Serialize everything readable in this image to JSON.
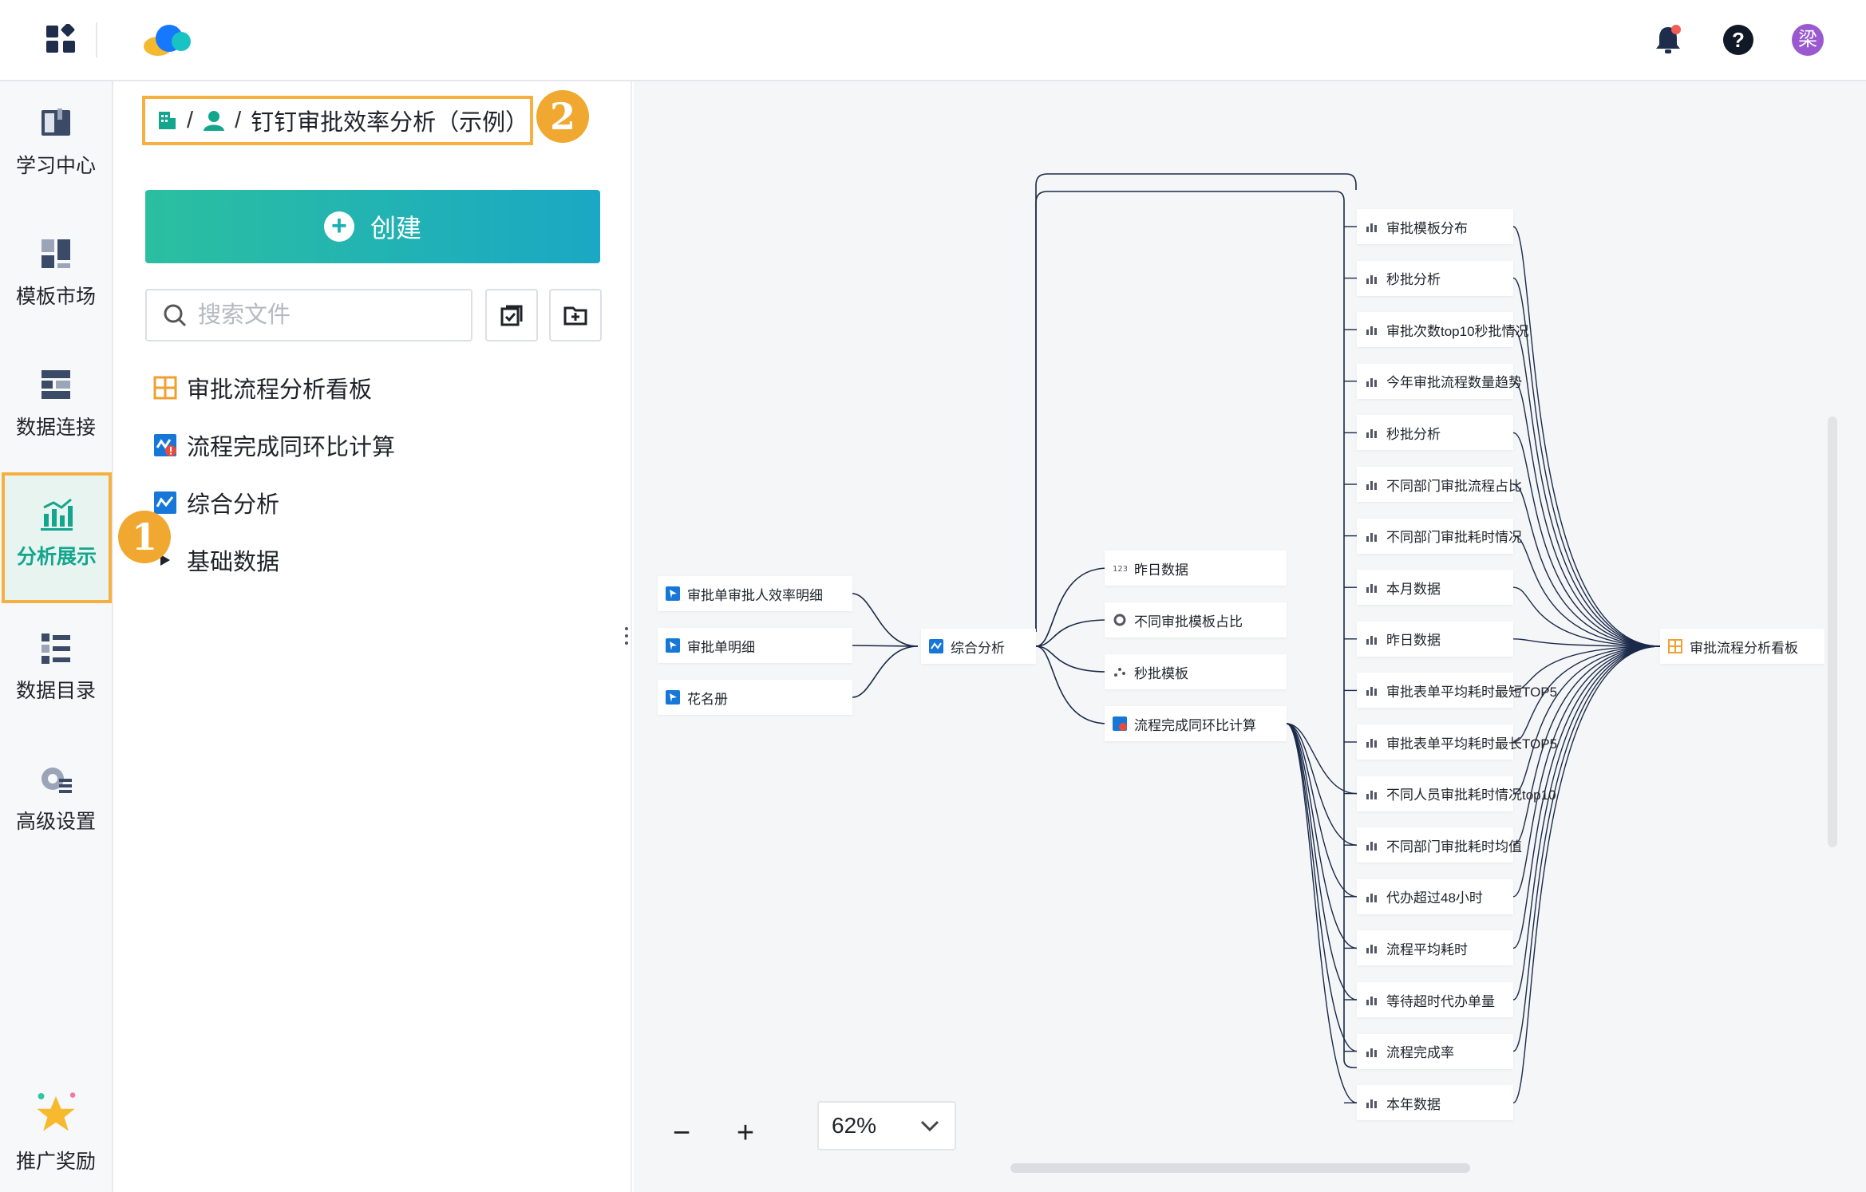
{
  "topbar": {
    "avatar_text": "梁",
    "icons": [
      "apps-grid-icon",
      "cloud-logo-icon",
      "bell-icon",
      "help-icon"
    ],
    "brand_colors": {
      "logo_yellow": "#f5b82e",
      "logo_blue": "#1677ff",
      "logo_teal": "#19c3c3",
      "avatar_bg": "#9b59d0"
    }
  },
  "sidebar": {
    "items": [
      {
        "label": "学习中心",
        "icon": "book-icon"
      },
      {
        "label": "模板市场",
        "icon": "template-icon"
      },
      {
        "label": "数据连接",
        "icon": "database-link-icon"
      },
      {
        "label": "分析展示",
        "icon": "chart-icon",
        "active": true
      },
      {
        "label": "数据目录",
        "icon": "catalog-icon"
      },
      {
        "label": "高级设置",
        "icon": "settings-icon"
      }
    ],
    "promo": {
      "label": "推广奖励",
      "icon": "star-icon"
    },
    "accent": "#14a58e",
    "highlight": "#f5b041"
  },
  "panel": {
    "breadcrumb": {
      "sep1": "/",
      "sep2": "/",
      "title": "钉钉审批效率分析（示例）"
    },
    "badges": {
      "one": "1",
      "two": "2"
    },
    "create_label": "创建",
    "search_placeholder": "搜索文件",
    "tree": [
      {
        "label": "审批流程分析看板",
        "icon": "dashboard-icon"
      },
      {
        "label": "流程完成同环比计算",
        "icon": "calc-dataset-icon"
      },
      {
        "label": "综合分析",
        "icon": "analysis-icon"
      },
      {
        "label": "基础数据",
        "icon": "caret-right-icon"
      }
    ]
  },
  "lineage": {
    "sources": [
      "审批单审批人效率明细",
      "审批单明细",
      "花名册"
    ],
    "hub": "综合分析",
    "middle": [
      "昨日数据",
      "不同审批模板占比",
      "秒批模板",
      "流程完成同环比计算"
    ],
    "charts": [
      "审批模板分布",
      "秒批分析",
      "审批次数top10秒批情况",
      "今年审批流程数量趋势",
      "秒批分析",
      "不同部门审批流程占比",
      "不同部门审批耗时情况",
      "本月数据",
      "昨日数据",
      "审批表单平均耗时最短TOP5",
      "审批表单平均耗时最长TOP5",
      "不同人员审批耗时情况top10",
      "不同部门审批耗时均值",
      "代办超过48小时",
      "流程平均耗时",
      "等待超时代办单量",
      "流程完成率",
      "本年数据"
    ],
    "target": "审批流程分析看板",
    "link_color": "#1b2a4a"
  },
  "zoom": {
    "minus": "−",
    "plus": "+",
    "value": "62%"
  }
}
